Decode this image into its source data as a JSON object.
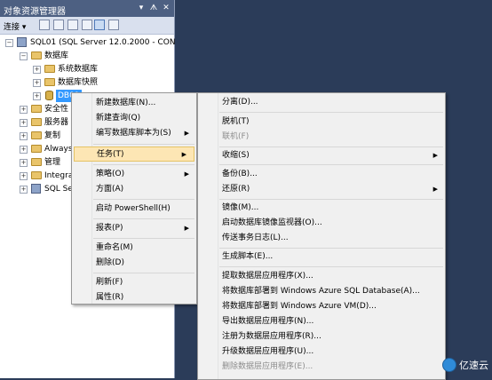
{
  "object_explorer": {
    "title": "对象资源管理器",
    "title_buttons": [
      "▾",
      "ᗑ",
      "✕"
    ],
    "toolbar": {
      "connect": "连接 ▾"
    },
    "tree": [
      {
        "label": "SQL01 (SQL Server 12.0.2000 - CON",
        "expander": "⊟",
        "icon": "server-icon",
        "selected": false
      },
      {
        "label": "数据库",
        "expander": "⊟",
        "icon": "folder-icon",
        "selected": false
      },
      {
        "label": "系统数据库",
        "expander": "⊞",
        "icon": "folder-icon",
        "selected": false
      },
      {
        "label": "数据库快照",
        "expander": "⊞",
        "icon": "folder-icon",
        "selected": false
      },
      {
        "label": "DB01",
        "expander": "⊞",
        "icon": "database-icon",
        "selected": true
      },
      {
        "label": "安全性",
        "expander": "⊞",
        "icon": "folder-icon",
        "selected": false
      },
      {
        "label": "服务器",
        "expander": "⊞",
        "icon": "folder-icon",
        "selected": false
      },
      {
        "label": "复制",
        "expander": "⊞",
        "icon": "folder-icon",
        "selected": false
      },
      {
        "label": "Always",
        "expander": "⊞",
        "icon": "folder-icon",
        "selected": false
      },
      {
        "label": "管理",
        "expander": "⊞",
        "icon": "folder-icon",
        "selected": false
      },
      {
        "label": "Integra",
        "expander": "⊞",
        "icon": "folder-icon",
        "selected": false
      },
      {
        "label": "SQL Se",
        "expander": "⊞",
        "icon": "server-agent-icon",
        "selected": false
      }
    ]
  },
  "context_menu": {
    "items": [
      {
        "label": "新建数据库(N)...",
        "submenu": false,
        "disabled": false,
        "highlighted": false
      },
      {
        "label": "新建查询(Q)",
        "submenu": false,
        "disabled": false,
        "highlighted": false
      },
      {
        "label": "编写数据库脚本为(S)",
        "submenu": true,
        "disabled": false,
        "highlighted": false
      },
      {
        "label": "任务(T)",
        "submenu": true,
        "disabled": false,
        "highlighted": true
      },
      {
        "label": "策略(O)",
        "submenu": true,
        "disabled": false,
        "highlighted": false
      },
      {
        "label": "方面(A)",
        "submenu": false,
        "disabled": false,
        "highlighted": false
      },
      {
        "label": "启动 PowerShell(H)",
        "submenu": false,
        "disabled": false,
        "highlighted": false
      },
      {
        "label": "报表(P)",
        "submenu": true,
        "disabled": false,
        "highlighted": false
      },
      {
        "label": "重命名(M)",
        "submenu": false,
        "disabled": false,
        "highlighted": false
      },
      {
        "label": "删除(D)",
        "submenu": false,
        "disabled": false,
        "highlighted": false
      },
      {
        "label": "刷新(F)",
        "submenu": false,
        "disabled": false,
        "highlighted": false
      },
      {
        "label": "属性(R)",
        "submenu": false,
        "disabled": false,
        "highlighted": false
      }
    ]
  },
  "tasks_submenu": {
    "items": [
      {
        "label": "分离(D)...",
        "submenu": false,
        "disabled": false
      },
      {
        "label": "脱机(T)",
        "submenu": false,
        "disabled": false
      },
      {
        "label": "联机(F)",
        "submenu": false,
        "disabled": true
      },
      {
        "label": "收缩(S)",
        "submenu": true,
        "disabled": false
      },
      {
        "label": "备份(B)...",
        "submenu": false,
        "disabled": false
      },
      {
        "label": "还原(R)",
        "submenu": true,
        "disabled": false
      },
      {
        "label": "镜像(M)...",
        "submenu": false,
        "disabled": false
      },
      {
        "label": "启动数据库镜像监视器(O)...",
        "submenu": false,
        "disabled": false
      },
      {
        "label": "传送事务日志(L)...",
        "submenu": false,
        "disabled": false
      },
      {
        "label": "生成脚本(E)...",
        "submenu": false,
        "disabled": false
      },
      {
        "label": "提取数据层应用程序(X)...",
        "submenu": false,
        "disabled": false
      },
      {
        "label": "将数据库部署到 Windows Azure SQL Database(A)...",
        "submenu": false,
        "disabled": false
      },
      {
        "label": "将数据库部署到 Windows Azure VM(D)...",
        "submenu": false,
        "disabled": false
      },
      {
        "label": "导出数据层应用程序(N)...",
        "submenu": false,
        "disabled": false
      },
      {
        "label": "注册为数据层应用程序(R)...",
        "submenu": false,
        "disabled": false
      },
      {
        "label": "升级数据层应用程序(U)...",
        "submenu": false,
        "disabled": false
      },
      {
        "label": "删除数据层应用程序(E)...",
        "submenu": false,
        "disabled": true
      }
    ]
  },
  "watermark": {
    "text": "亿速云"
  }
}
